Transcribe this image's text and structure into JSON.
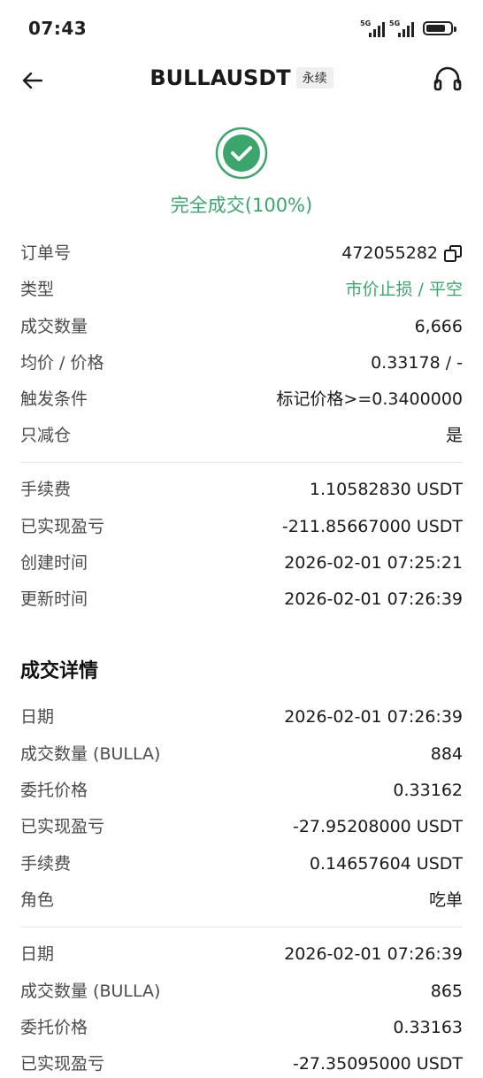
{
  "status_bar": {
    "time": "07:43",
    "signal1": "5G",
    "signal2": "5G"
  },
  "nav": {
    "title": "BULLAUSDT",
    "tag": "永续"
  },
  "status": {
    "text": "完全成交(100%)"
  },
  "order": {
    "rows": [
      {
        "label": "订单号",
        "value": "472055282"
      },
      {
        "label": "类型",
        "value": "市价止损 / 平空"
      },
      {
        "label": "成交数量",
        "value": "6,666"
      },
      {
        "label": "均价 / 价格",
        "value": "0.33178 / -"
      },
      {
        "label": "触发条件",
        "value": "标记价格>=0.3400000"
      },
      {
        "label": "只减仓",
        "value": "是"
      },
      {
        "label": "手续费",
        "value": "1.10582830 USDT"
      },
      {
        "label": "已实现盈亏",
        "value": "-211.85667000 USDT"
      },
      {
        "label": "创建时间",
        "value": "2026-02-01 07:25:21"
      },
      {
        "label": "更新时间",
        "value": "2026-02-01 07:26:39"
      }
    ]
  },
  "details": {
    "title": "成交详情",
    "trades": [
      [
        {
          "label": "日期",
          "value": "2026-02-01 07:26:39"
        },
        {
          "label": "成交数量 (BULLA)",
          "value": "884"
        },
        {
          "label": "委托价格",
          "value": "0.33162"
        },
        {
          "label": "已实现盈亏",
          "value": "-27.95208000 USDT"
        },
        {
          "label": "手续费",
          "value": "0.14657604 USDT"
        },
        {
          "label": "角色",
          "value": "吃单"
        }
      ],
      [
        {
          "label": "日期",
          "value": "2026-02-01 07:26:39"
        },
        {
          "label": "成交数量 (BULLA)",
          "value": "865"
        },
        {
          "label": "委托价格",
          "value": "0.33163"
        },
        {
          "label": "已实现盈亏",
          "value": "-27.35095000 USDT"
        }
      ]
    ]
  }
}
